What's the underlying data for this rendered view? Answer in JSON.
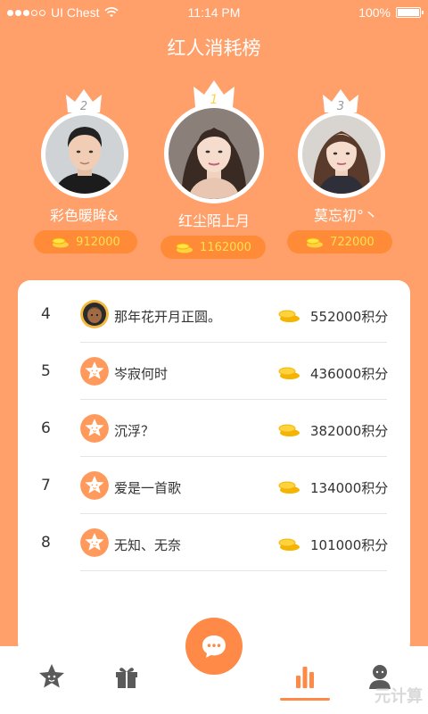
{
  "status_bar": {
    "carrier": "UI Chest",
    "time": "11:14 PM",
    "battery": "100%",
    "signal_bars": [
      true,
      true,
      true,
      false,
      false
    ],
    "wifi_icon": "wifi-icon",
    "battery_icon": "battery-icon",
    "battery_level": 1.0
  },
  "title": "红人消耗榜",
  "colors": {
    "accent": "#FF8A48",
    "background": "#FFA06A",
    "score_text": "#FFE34A",
    "crown": "#FFFFFF",
    "crown_first_label": "#FFD23F",
    "crown_other_label": "#9A9A9A"
  },
  "podium": [
    {
      "rank": "2",
      "name": "彩色暖眸&",
      "score": "912000",
      "avatar_icon": "male-avatar-photo",
      "crown_icon": "crown-icon",
      "coin_icon": "coin-icon"
    },
    {
      "rank": "1",
      "name": "红尘陌上月",
      "score": "1162000",
      "avatar_icon": "female-avatar-photo",
      "crown_icon": "crown-icon",
      "coin_icon": "coin-icon"
    },
    {
      "rank": "3",
      "name": "莫忘初°丶",
      "score": "722000",
      "avatar_icon": "female-avatar-photo",
      "crown_icon": "crown-icon",
      "coin_icon": "coin-icon"
    }
  ],
  "ranking": [
    {
      "rank": "4",
      "name": "那年花开月正圆。",
      "score": "552000积分",
      "avatar_icon": "user-photo-avatar"
    },
    {
      "rank": "5",
      "name": "岑寂何时",
      "score": "436000积分",
      "avatar_icon": "star-face-avatar"
    },
    {
      "rank": "6",
      "name": "沉浮？",
      "score": "382000积分",
      "avatar_icon": "star-face-avatar"
    },
    {
      "rank": "7",
      "name": "爱是一首歌",
      "score": "134000积分",
      "avatar_icon": "star-face-avatar"
    },
    {
      "rank": "8",
      "name": "无知、无奈",
      "score": "101000积分",
      "avatar_icon": "star-face-avatar"
    }
  ],
  "tab_bar": {
    "tabs": [
      {
        "icon": "star-face-icon",
        "active": false
      },
      {
        "icon": "gift-icon",
        "active": false
      },
      {
        "icon": "chat-bubble-icon",
        "active": false
      },
      {
        "icon": "bar-chart-icon",
        "active": true
      },
      {
        "icon": "profile-icon",
        "active": false
      }
    ]
  },
  "watermark": "元计算"
}
